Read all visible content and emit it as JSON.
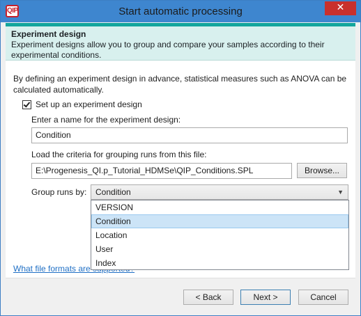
{
  "window": {
    "title": "Start automatic processing",
    "logo_text": "QIP",
    "close_glyph": "✕"
  },
  "header": {
    "title": "Experiment design",
    "description": "Experiment designs allow you to group and compare your samples according to their experimental conditions."
  },
  "content": {
    "intro": "By defining an experiment design in advance, statistical measures such as ANOVA can be calculated automatically.",
    "setup_checkbox": {
      "label": "Set up an experiment design",
      "checked": true
    },
    "name_label": "Enter a name for the experiment design:",
    "name_value": "Condition",
    "file_label": "Load the criteria for grouping runs from this file:",
    "file_value": "E:\\Progenesis_QI.p_Tutorial_HDMSe\\QIP_Conditions.SPL",
    "browse_label": "Browse...",
    "group_label": "Group runs by:",
    "group_value": "Condition",
    "group_options": [
      "VERSION",
      "Condition",
      "Location",
      "User",
      "Index"
    ],
    "help_link": "What file formats are supported?"
  },
  "footer": {
    "back_label": "< Back",
    "next_label": "Next >",
    "cancel_label": "Cancel"
  },
  "colors": {
    "titlebar": "#3e86cf",
    "header_accent": "#12a59c",
    "header_bg": "#d8f0ee",
    "close_button": "#c9302c",
    "link": "#1f6fc5",
    "selected_option": "#cce4f7"
  }
}
